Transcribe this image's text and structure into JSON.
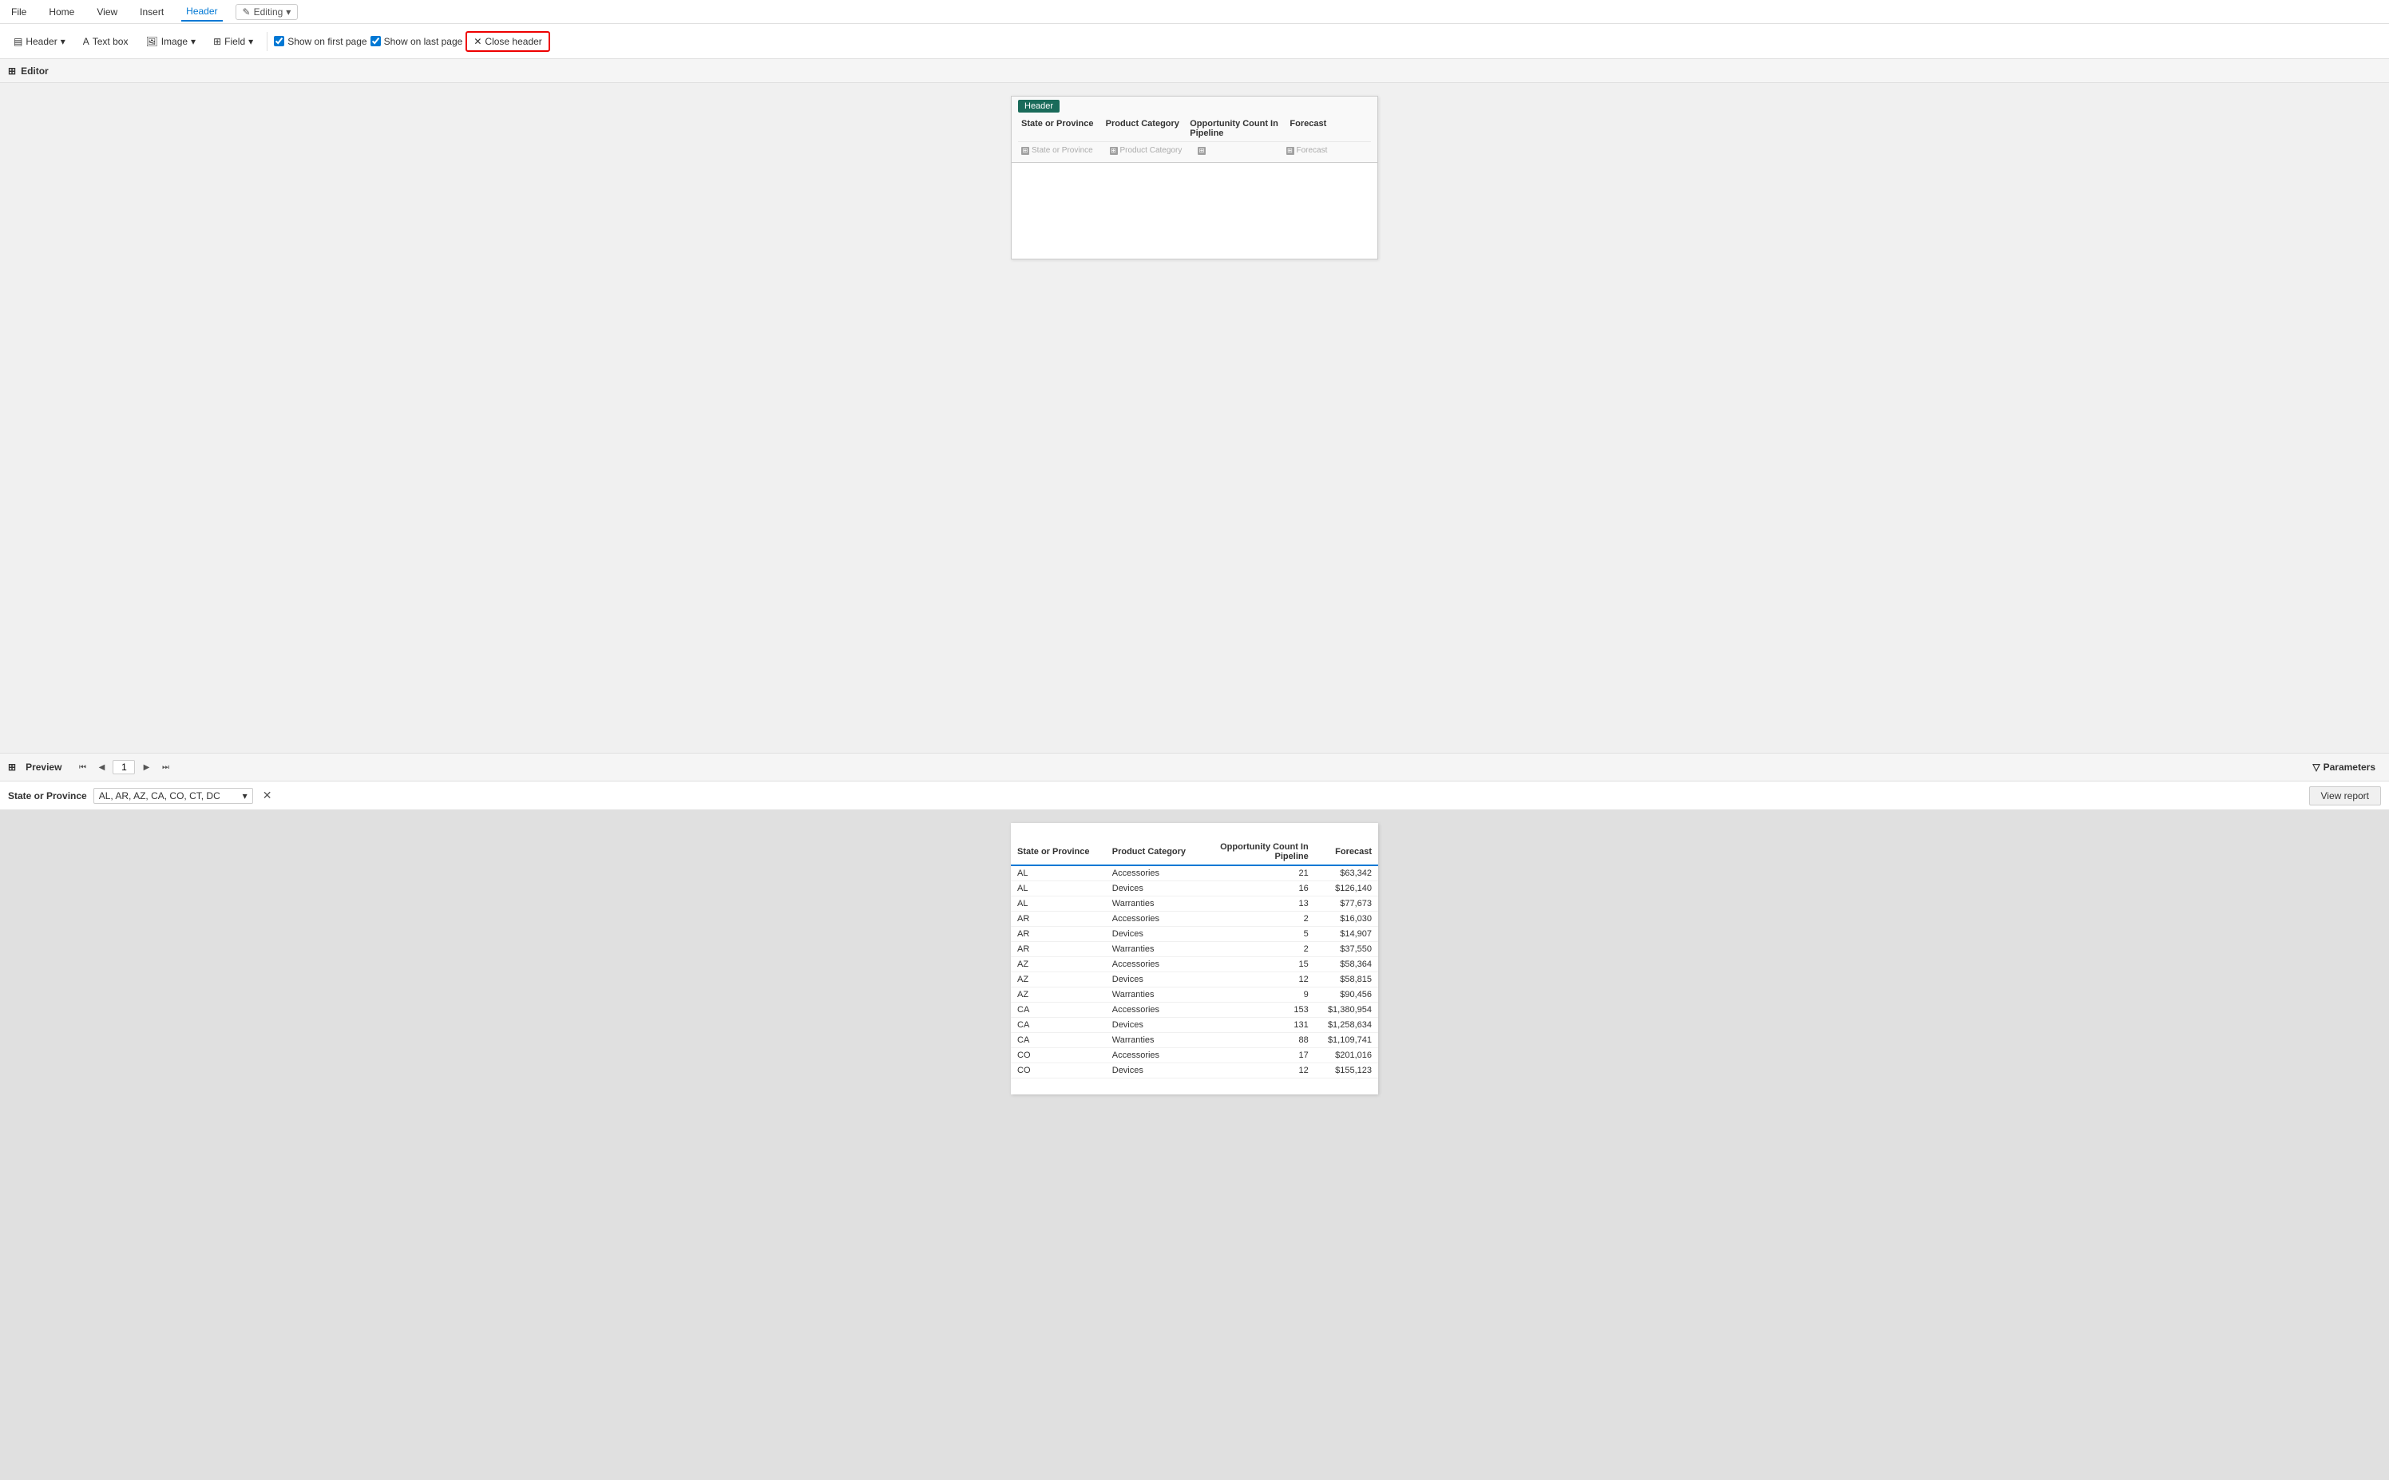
{
  "menu": {
    "items": [
      {
        "label": "File",
        "active": false
      },
      {
        "label": "Home",
        "active": false
      },
      {
        "label": "View",
        "active": false
      },
      {
        "label": "Insert",
        "active": false
      },
      {
        "label": "Header",
        "active": true
      }
    ],
    "editing_label": "Editing",
    "editing_icon": "✎"
  },
  "ribbon": {
    "header_btn": "Header",
    "textbox_btn": "Text box",
    "image_btn": "Image",
    "field_btn": "Field",
    "show_first_label": "Show on first page",
    "show_last_label": "Show on last page",
    "close_header_label": "Close header"
  },
  "editor": {
    "label": "Editor",
    "header_badge": "Header",
    "columns": [
      {
        "label": "State or Province"
      },
      {
        "label": "Product Category"
      },
      {
        "label": "Opportunity Count In Pipeline"
      },
      {
        "label": "Forecast"
      }
    ],
    "data_placeholders": [
      "State or Province",
      "Product Category",
      "",
      "Forecast"
    ]
  },
  "preview": {
    "label": "Preview",
    "page_number": "1",
    "parameters_label": "Parameters"
  },
  "parameters": {
    "label": "State or Province",
    "value": "AL, AR, AZ, CA, CO, CT, DC",
    "view_report_label": "View report"
  },
  "table": {
    "columns": [
      "State or Province",
      "Product Category",
      "Opportunity Count In Pipeline",
      "Forecast"
    ],
    "rows": [
      [
        "AL",
        "Accessories",
        "21",
        "$63,342"
      ],
      [
        "AL",
        "Devices",
        "16",
        "$126,140"
      ],
      [
        "AL",
        "Warranties",
        "13",
        "$77,673"
      ],
      [
        "AR",
        "Accessories",
        "2",
        "$16,030"
      ],
      [
        "AR",
        "Devices",
        "5",
        "$14,907"
      ],
      [
        "AR",
        "Warranties",
        "2",
        "$37,550"
      ],
      [
        "AZ",
        "Accessories",
        "15",
        "$58,364"
      ],
      [
        "AZ",
        "Devices",
        "12",
        "$58,815"
      ],
      [
        "AZ",
        "Warranties",
        "9",
        "$90,456"
      ],
      [
        "CA",
        "Accessories",
        "153",
        "$1,380,954"
      ],
      [
        "CA",
        "Devices",
        "131",
        "$1,258,634"
      ],
      [
        "CA",
        "Warranties",
        "88",
        "$1,109,741"
      ],
      [
        "CO",
        "Accessories",
        "17",
        "$201,016"
      ],
      [
        "CO",
        "Devices",
        "12",
        "$155,123"
      ]
    ]
  }
}
